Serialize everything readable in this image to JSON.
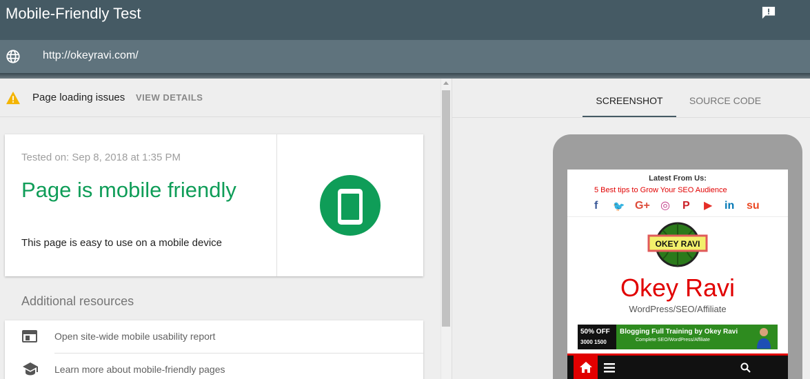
{
  "header": {
    "title": "Mobile-Friendly Test",
    "feedback_icon": "feedback-icon"
  },
  "urlbar": {
    "url": "http://okeyravi.com/",
    "icon": "globe-icon"
  },
  "issues": {
    "text": "Page loading issues",
    "action": "VIEW DETAILS",
    "icon": "warning-icon"
  },
  "result": {
    "tested_on": "Tested on: Sep 8, 2018 at 1:35 PM",
    "verdict": "Page is mobile friendly",
    "description": "This page is easy to use on a mobile device",
    "icon": "smartphone-icon",
    "color": "#0f9d58"
  },
  "resources": {
    "heading": "Additional resources",
    "items": [
      {
        "label": "Open site-wide mobile usability report",
        "icon": "web-icon"
      },
      {
        "label": "Learn more about mobile-friendly pages",
        "icon": "school-icon"
      }
    ]
  },
  "tabs": [
    {
      "label": "SCREENSHOT",
      "active": true
    },
    {
      "label": "SOURCE CODE",
      "active": false
    }
  ],
  "preview": {
    "latest_label": "Latest From Us:",
    "latest_link": "5 Best tips to Grow Your SEO Audience",
    "social": [
      {
        "glyph": "f",
        "icon": "facebook-icon",
        "color": "#3b5998"
      },
      {
        "glyph": "🐦",
        "icon": "twitter-icon",
        "color": "#1da1f2"
      },
      {
        "glyph": "G+",
        "icon": "google-plus-icon",
        "color": "#dd4b39"
      },
      {
        "glyph": "◎",
        "icon": "instagram-icon",
        "color": "#c13584"
      },
      {
        "glyph": "P",
        "icon": "pinterest-icon",
        "color": "#cb2027"
      },
      {
        "glyph": "▶",
        "icon": "youtube-icon",
        "color": "#e52d27"
      },
      {
        "glyph": "in",
        "icon": "linkedin-icon",
        "color": "#0077b5"
      },
      {
        "glyph": "su",
        "icon": "stumbleupon-icon",
        "color": "#eb4924"
      }
    ],
    "logo_text": "OKEY RAVI",
    "site_name": "Okey Ravi",
    "tagline": "WordPress/SEO/Affiliate",
    "banner": {
      "discount": "50% OFF",
      "price": "3000 1500",
      "title": "Blogging Full Training by Okey Ravi",
      "subtitle": "Complete SEO/WordPress/Affiliate"
    },
    "brand_color": "#e10000"
  }
}
